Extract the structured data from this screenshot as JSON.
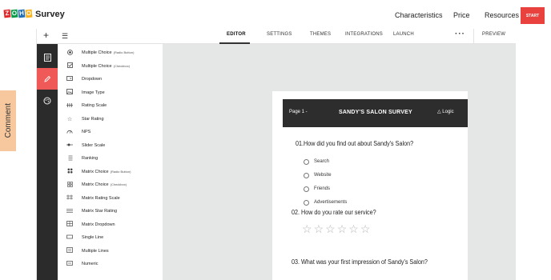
{
  "header": {
    "logo_letters": [
      "Z",
      "O",
      "H",
      "O"
    ],
    "logo_colors": [
      "#e42527",
      "#089949",
      "#226db4",
      "#f9b21d"
    ],
    "app_title": "Survey",
    "nav": [
      "Characteristics",
      "Price",
      "Resources"
    ],
    "start_label": "START"
  },
  "comment_tab": {
    "label": "Comment"
  },
  "toolbar": {
    "add_icon": "plus-icon",
    "list_icon": "list-icon",
    "tabs": [
      "EDITOR",
      "SETTINGS",
      "THEMES",
      "INTEGRATIONS",
      "LAUNCH"
    ],
    "active_tab": "EDITOR",
    "more_icon": "more-dots-icon",
    "preview_label": "PREVIEW"
  },
  "rail": {
    "items": [
      "document-icon",
      "pencil-icon",
      "palette-icon"
    ],
    "active_index": 1,
    "accent": "#ef5a58"
  },
  "question_types": [
    {
      "label": "Multiple Choice",
      "sub": "(Radio Button)",
      "icon": "radio-icon"
    },
    {
      "label": "Multiple Choice",
      "sub": "(Checkbox)",
      "icon": "checkbox-icon"
    },
    {
      "label": "Dropdown",
      "sub": "",
      "icon": "dropdown-icon"
    },
    {
      "label": "Image Type",
      "sub": "",
      "icon": "image-icon"
    },
    {
      "label": "Rating Scale",
      "sub": "",
      "icon": "rating-scale-icon"
    },
    {
      "label": "Star Rating",
      "sub": "",
      "icon": "star-icon"
    },
    {
      "label": "NPS",
      "sub": "",
      "icon": "nps-gauge-icon"
    },
    {
      "label": "Slider Scale",
      "sub": "",
      "icon": "slider-icon"
    },
    {
      "label": "Ranking",
      "sub": "",
      "icon": "ranking-icon"
    },
    {
      "label": "Matrix Choice",
      "sub": "(Radio Button)",
      "icon": "matrix-radio-icon"
    },
    {
      "label": "Matrix Choice",
      "sub": "(Checkbox)",
      "icon": "matrix-checkbox-icon"
    },
    {
      "label": "Matrix Rating Scale",
      "sub": "",
      "icon": "matrix-rating-icon"
    },
    {
      "label": "Matrix Star Rating",
      "sub": "",
      "icon": "matrix-star-icon"
    },
    {
      "label": "Matrix Dropdown",
      "sub": "",
      "icon": "matrix-dropdown-icon"
    },
    {
      "label": "Single Line",
      "sub": "",
      "icon": "single-line-icon"
    },
    {
      "label": "Multiple Lines",
      "sub": "",
      "icon": "multiple-lines-icon"
    },
    {
      "label": "Numeric",
      "sub": "",
      "icon": "numeric-icon"
    }
  ],
  "survey": {
    "page_label": "Page 1 -",
    "title": "SANDY'S SALON SURVEY",
    "logic_label": "Logic",
    "questions": [
      {
        "title": "01.How did you find out about Sandy's Salon?",
        "options": [
          "Search",
          "Website",
          "Friends",
          "Advertisements"
        ]
      },
      {
        "title": "02. How do you rate our service?",
        "stars": 6
      },
      {
        "title": "03. What was your first impression of Sandy's Salon?"
      }
    ]
  }
}
